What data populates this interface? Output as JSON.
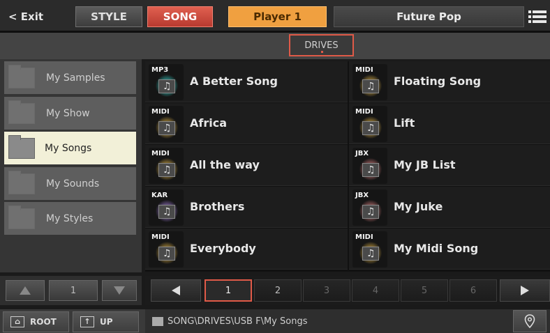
{
  "topbar": {
    "exit_label": "< Exit",
    "style_label": "STYLE",
    "song_label": "SONG",
    "player_label": "Player 1",
    "song_title": "Future Pop",
    "menu_icon": "list-menu-icon"
  },
  "drivebar": {
    "drives_label": "DRIVES"
  },
  "folders": [
    {
      "label": "My Samples",
      "selected": false
    },
    {
      "label": "My Show",
      "selected": false
    },
    {
      "label": "My Songs",
      "selected": true
    },
    {
      "label": "My Sounds",
      "selected": false
    },
    {
      "label": "My Styles",
      "selected": false
    }
  ],
  "left_pager": {
    "page": "1"
  },
  "songs": [
    {
      "type": "MP3",
      "name": "A Better Song",
      "glow": "#2fb8b0"
    },
    {
      "type": "MIDI",
      "name": "Floating Song",
      "glow": "#c8a040"
    },
    {
      "type": "MIDI",
      "name": "Africa",
      "glow": "#c8a040"
    },
    {
      "type": "MIDI",
      "name": "Lift",
      "glow": "#c8a040"
    },
    {
      "type": "MIDI",
      "name": "All the way",
      "glow": "#c8a040"
    },
    {
      "type": "JBX",
      "name": "My JB List",
      "glow": "#c07070"
    },
    {
      "type": "KAR",
      "name": "Brothers",
      "glow": "#9070c0"
    },
    {
      "type": "JBX",
      "name": "My Juke",
      "glow": "#c07070"
    },
    {
      "type": "MIDI",
      "name": "Everybody",
      "glow": "#c8a040"
    },
    {
      "type": "MIDI",
      "name": "My Midi Song",
      "glow": "#c8a040"
    }
  ],
  "pager": {
    "pages": [
      "1",
      "2",
      "3",
      "4",
      "5",
      "6"
    ],
    "active_page": "1",
    "enabled_pages": [
      "1",
      "2"
    ]
  },
  "footer": {
    "root_label": "ROOT",
    "up_label": "UP",
    "path": "SONG\\DRIVES\\USB F\\My Songs"
  },
  "colors": {
    "accent": "#e05a48",
    "player": "#f0a040",
    "selected_folder": "#f2f0d8"
  }
}
